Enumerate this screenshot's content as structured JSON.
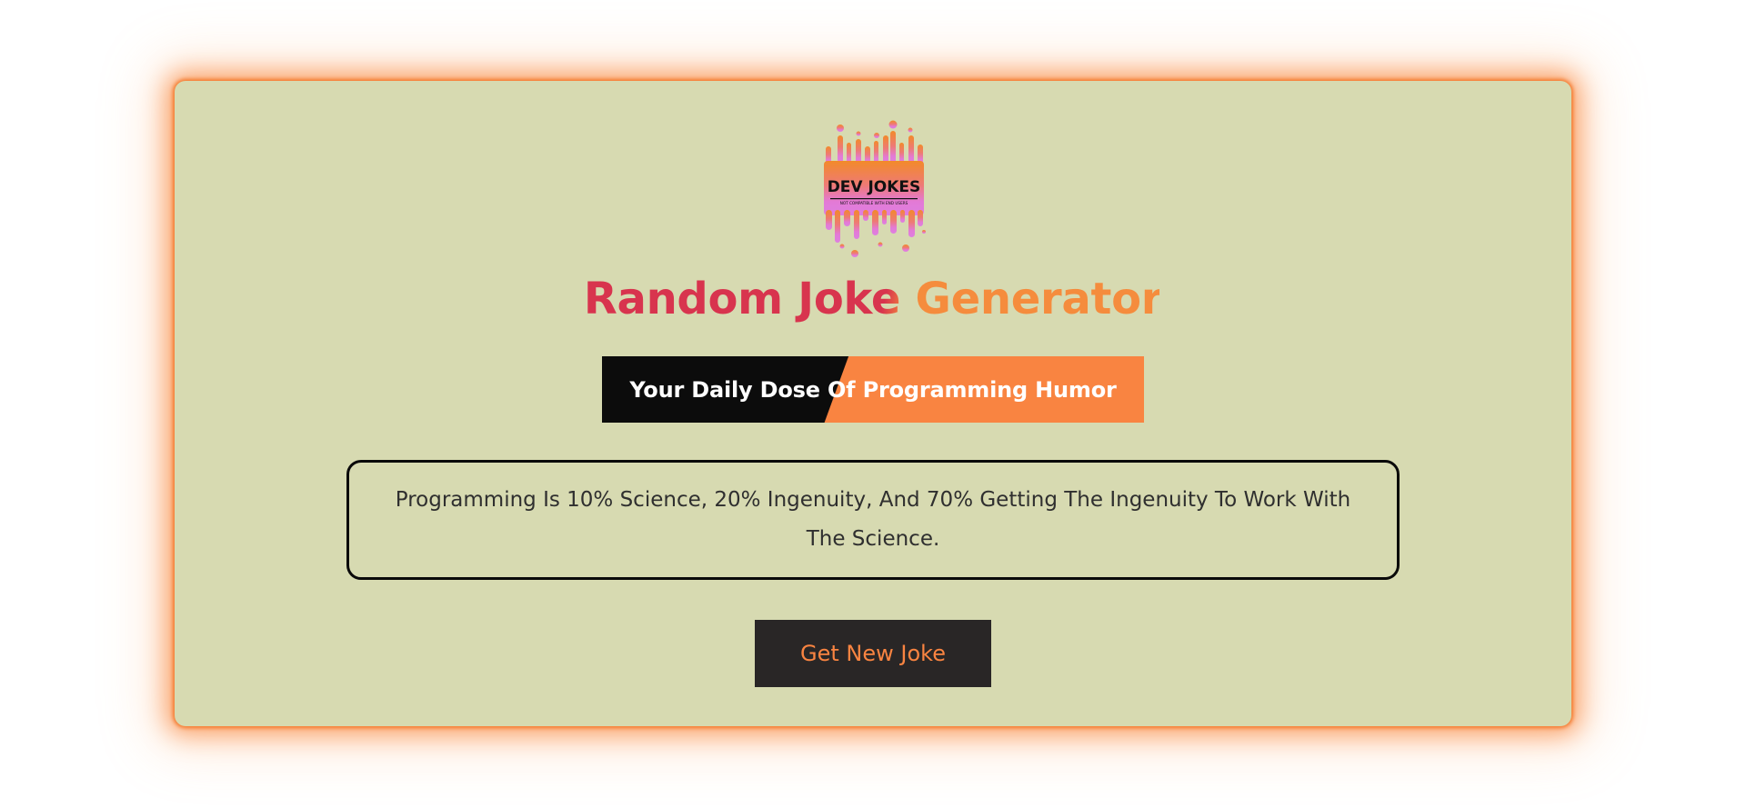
{
  "logo": {
    "text": "DEV JOKES",
    "subtext": "NOT COMPATIBLE WITH END USERS"
  },
  "title": "Random Joke Generator",
  "tagline": "Your Daily Dose Of Programming Humor",
  "joke": "Programming Is 10% Science, 20% Ingenuity, And 70% Getting The Ingenuity To Work With The Science.",
  "button_label": "Get New Joke",
  "colors": {
    "card_bg": "#d7dab1",
    "glow": "#f4782a",
    "title_red": "#d8344e",
    "title_orange": "#f58c3d",
    "tagline_black": "#0c0c0c",
    "tagline_orange": "#f98441",
    "button_bg": "#292626",
    "button_text": "#f98441"
  }
}
